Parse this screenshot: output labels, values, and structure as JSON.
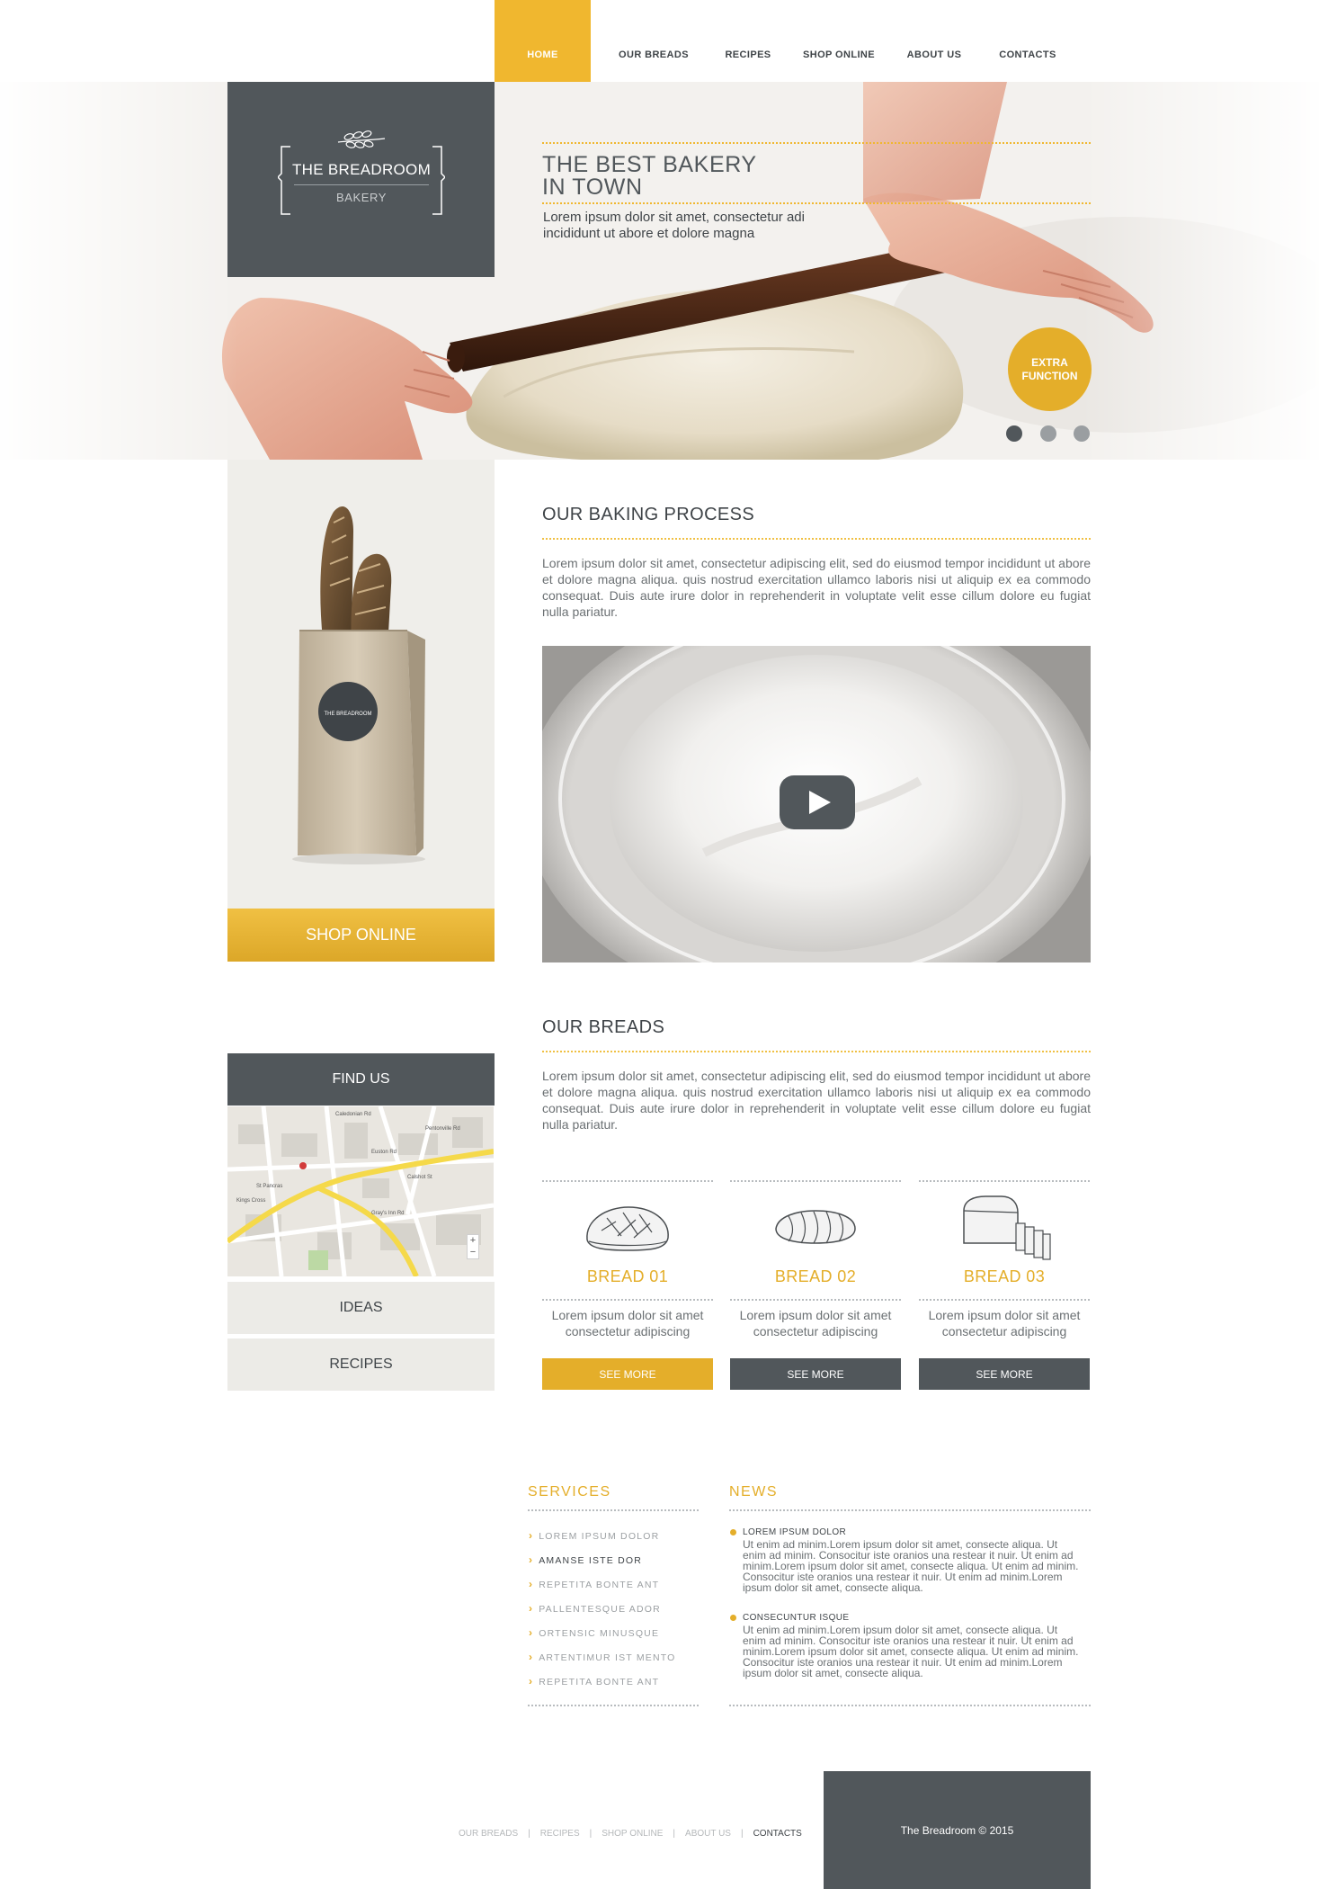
{
  "nav": {
    "items": [
      {
        "label": "HOME",
        "active": true
      },
      {
        "label": "OUR BREADS",
        "active": false
      },
      {
        "label": "RECIPES",
        "active": false
      },
      {
        "label": "SHOP ONLINE",
        "active": false
      },
      {
        "label": "ABOUT US",
        "active": false
      },
      {
        "label": "CONTACTS",
        "active": false
      }
    ]
  },
  "logo": {
    "title": "THE BREADROOM",
    "subtitle": "BAKERY",
    "icon": "wheat-icon"
  },
  "hero": {
    "title_line1": "THE BEST BAKERY",
    "title_line2": "IN TOWN",
    "text": "Lorem ipsum dolor sit amet, consectetur adi incididunt ut abore et dolore magna",
    "extra_button_line1": "EXTRA",
    "extra_button_line2": "FUNCTION",
    "slider": {
      "total": 3,
      "active": 1
    }
  },
  "left": {
    "bag_label": "THE BREADROOM",
    "shop_online": "SHOP ONLINE",
    "find_us": "FIND US",
    "ideas": "IDEAS",
    "recipes": "RECIPES",
    "map": {
      "zoom_in": "+",
      "zoom_out": "−",
      "labels": [
        "Caledonian Rd",
        "Gray's Inn Rd",
        "Euston Rd",
        "St Pancras",
        "Kings Cross",
        "Calshot St",
        "Pentonville Rd"
      ]
    }
  },
  "baking": {
    "title": "OUR BAKING PROCESS",
    "text": "Lorem ipsum dolor sit amet, consectetur adipiscing elit, sed do eiusmod tempor incididunt ut abore et dolore magna aliqua. quis nostrud exercitation ullamco laboris nisi ut aliquip ex ea commodo consequat. Duis aute irure dolor in reprehenderit in voluptate velit esse cillum dolore eu fugiat nulla pariatur."
  },
  "breads": {
    "title": "OUR BREADS",
    "text": "Lorem ipsum dolor sit amet, consectetur adipiscing elit, sed do eiusmod tempor incididunt ut abore et dolore magna aliqua. quis nostrud exercitation ullamco laboris nisi ut aliquip ex ea commodo consequat. Duis aute irure dolor in reprehenderit in voluptate velit esse cillum dolore eu fugiat nulla pariatur.",
    "items": [
      {
        "name": "BREAD 01",
        "desc_line1": "Lorem ipsum dolor sit amet",
        "desc_line2": "consectetur adipiscing",
        "button": "SEE MORE",
        "button_color": "#e4ae2a",
        "icon": "round-loaf-icon"
      },
      {
        "name": "BREAD 02",
        "desc_line1": "Lorem ipsum dolor sit amet",
        "desc_line2": "consectetur adipiscing",
        "button": "SEE MORE",
        "button_color": "#51575b",
        "icon": "braided-loaf-icon"
      },
      {
        "name": "BREAD 03",
        "desc_line1": "Lorem ipsum dolor sit amet",
        "desc_line2": "consectetur adipiscing",
        "button": "SEE MORE",
        "button_color": "#51575b",
        "icon": "sliced-loaf-icon"
      }
    ]
  },
  "services": {
    "title": "SERVICES",
    "items": [
      {
        "label": "LOREM IPSUM DOLOR",
        "dark": false
      },
      {
        "label": "AMANSE ISTE DOR",
        "dark": true
      },
      {
        "label": "REPETITA BONTE ANT",
        "dark": false
      },
      {
        "label": "PALLENTESQUE ADOR",
        "dark": false
      },
      {
        "label": "ORTENSIC MINUSQUE",
        "dark": false
      },
      {
        "label": "ARTENTIMUR IST MENTO",
        "dark": false
      },
      {
        "label": "REPETITA BONTE ANT",
        "dark": false
      }
    ]
  },
  "news": {
    "title": "NEWS",
    "items": [
      {
        "heading": "LOREM IPSUM DOLOR",
        "lines": [
          "Ut enim ad minim.Lorem ipsum dolor sit amet, consecte aliqua. Ut",
          "enim ad minim. Consocitur iste oranios una restear it nuir. Ut enim ad",
          "minim.Lorem ipsum dolor sit amet, consecte aliqua. Ut enim ad minim.",
          "Consocitur iste oranios una restear it nuir. Ut enim ad minim.Lorem",
          "ipsum dolor sit amet, consecte aliqua."
        ]
      },
      {
        "heading": "CONSECUNTUR ISQUE",
        "lines": [
          "Ut enim ad minim.Lorem ipsum dolor sit amet, consecte aliqua. Ut",
          "enim ad minim. Consocitur iste oranios una restear it nuir. Ut enim ad",
          "minim.Lorem ipsum dolor sit amet, consecte aliqua. Ut enim ad minim.",
          "Consocitur iste oranios una restear it nuir. Ut enim ad minim.Lorem",
          "ipsum dolor sit amet, consecte aliqua."
        ]
      }
    ]
  },
  "footer": {
    "links": [
      {
        "label": "OUR BREADS",
        "active": false
      },
      {
        "label": "RECIPES",
        "active": false
      },
      {
        "label": "SHOP ONLINE",
        "active": false
      },
      {
        "label": "ABOUT US",
        "active": false
      },
      {
        "label": "CONTACTS",
        "active": true
      }
    ],
    "separator": "|",
    "copyright": "The Breadroom © 2015"
  },
  "colors": {
    "accent": "#e4ae2a",
    "dark": "#51575b",
    "light_panel": "#efeeea"
  }
}
